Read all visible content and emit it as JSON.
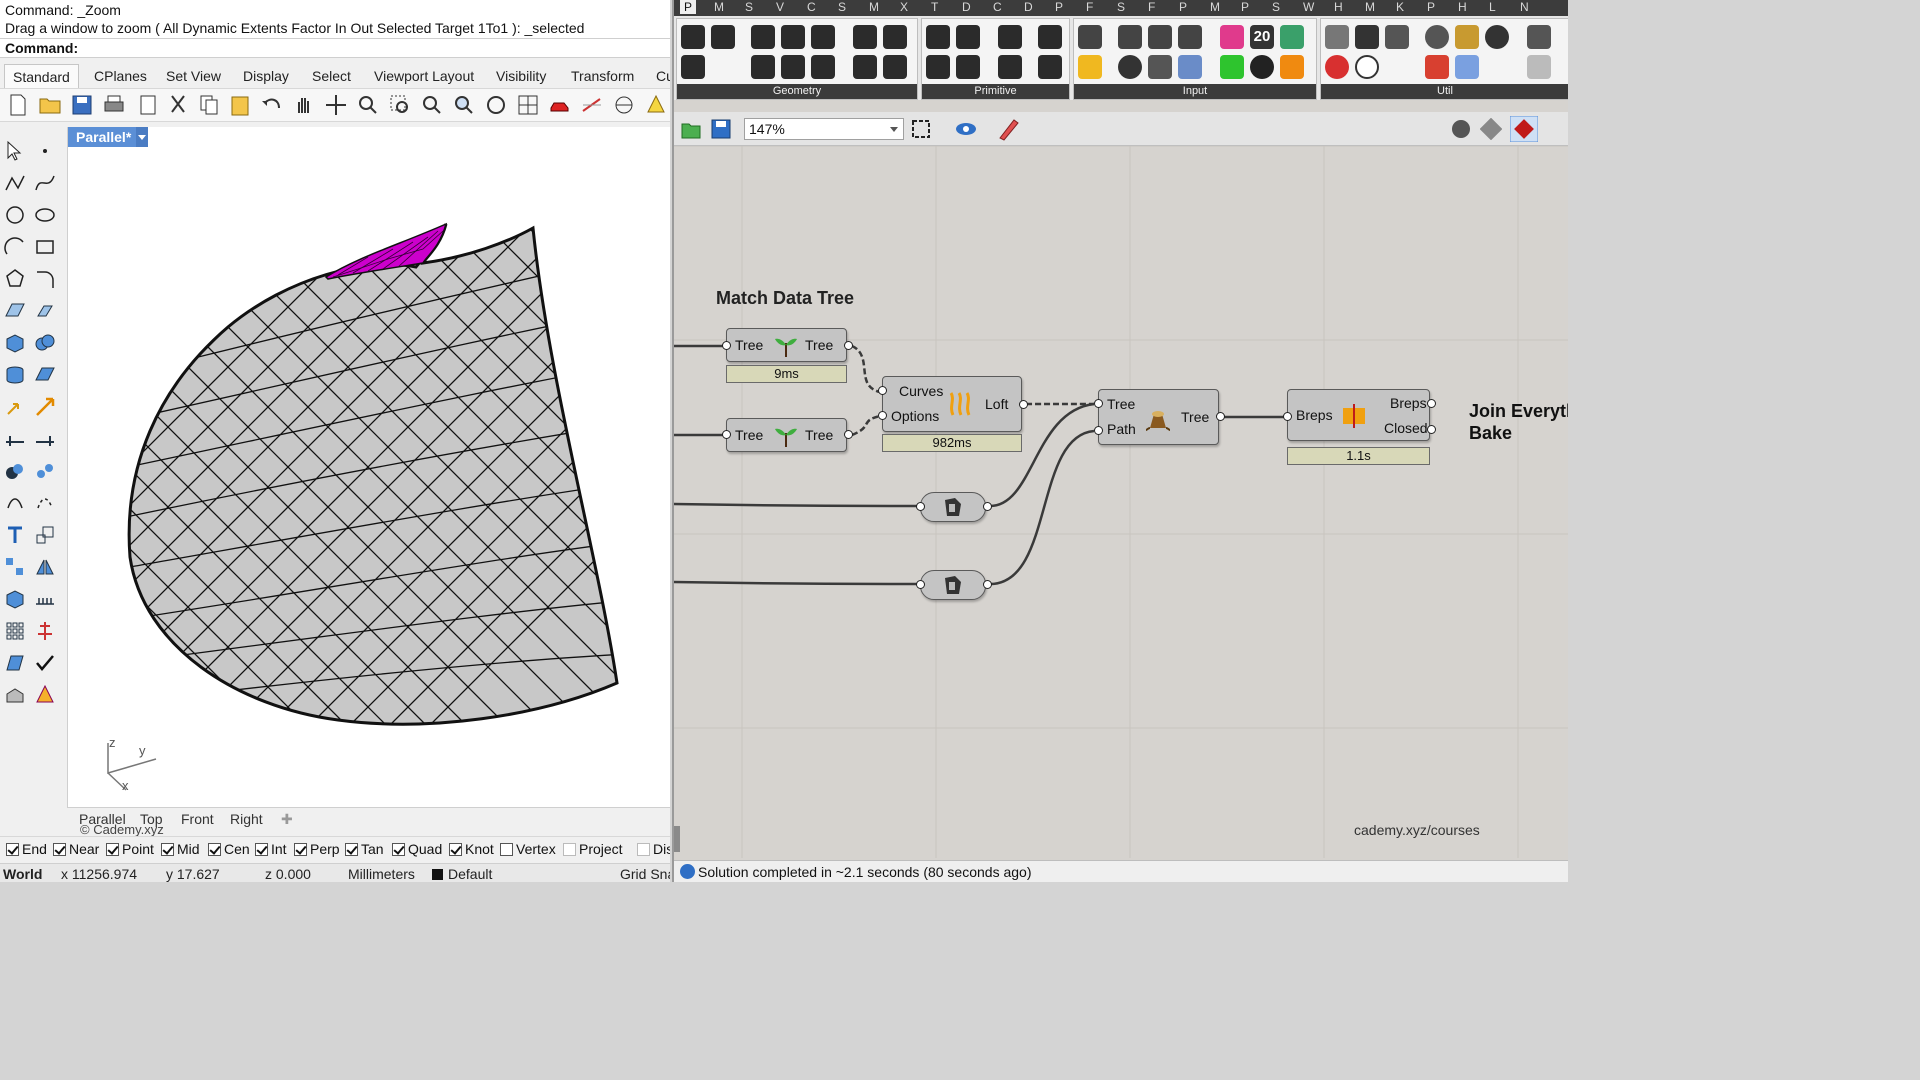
{
  "rhino": {
    "command_history": [
      "Command: _Zoom",
      "Drag a window to zoom ( All  Dynamic  Extents  Factor  In  Out  Selected  Target  1To1 ): _selected"
    ],
    "command_prompt": "Command:",
    "tabs": [
      "Standard",
      "CPlanes",
      "Set View",
      "Display",
      "Select",
      "Viewport Layout",
      "Visibility",
      "Transform",
      "Cu"
    ],
    "active_tab": "Standard",
    "viewport_label": "Parallel*",
    "axes": {
      "z": "z",
      "y": "y",
      "x": "x"
    },
    "viewport_tabs": [
      "Parallel",
      "Top",
      "Front",
      "Right"
    ],
    "watermark": "© Cademy.xyz",
    "osnaps": [
      {
        "label": "End",
        "checked": true
      },
      {
        "label": "Near",
        "checked": true
      },
      {
        "label": "Point",
        "checked": true
      },
      {
        "label": "Mid",
        "checked": true
      },
      {
        "label": "Cen",
        "checked": true
      },
      {
        "label": "Int",
        "checked": true
      },
      {
        "label": "Perp",
        "checked": true
      },
      {
        "label": "Tan",
        "checked": true
      },
      {
        "label": "Quad",
        "checked": true
      },
      {
        "label": "Knot",
        "checked": true
      },
      {
        "label": "Vertex",
        "checked": false
      },
      {
        "label": "Project",
        "checked": false
      },
      {
        "label": "Dis",
        "checked": false
      }
    ],
    "status": {
      "cplane": "World",
      "x": "x 11256.974",
      "y": "y 17.627",
      "z": "z 0.000",
      "units": "Millimeters",
      "layer": "Default",
      "grid_snap": "Grid Sna"
    },
    "colors": {
      "selection": "#cc00cc",
      "surface": "#c8c8c8"
    }
  },
  "grasshopper": {
    "categories": [
      "P",
      "M",
      "S",
      "V",
      "C",
      "S",
      "M",
      "X",
      "T",
      "D",
      "C",
      "D",
      "P",
      "F",
      "S",
      "F",
      "P",
      "M",
      "P",
      "S",
      "W",
      "H",
      "M",
      "K",
      "P",
      "H",
      "L",
      "N"
    ],
    "ribbon_groups": [
      "Geometry",
      "Primitive",
      "Input",
      "Util"
    ],
    "zoom": "147%",
    "group_title": "Match Data Tree",
    "nodes": {
      "tree1": {
        "in": "Tree",
        "out": "Tree",
        "time": "9ms"
      },
      "tree2": {
        "in": "Tree",
        "out": "Tree"
      },
      "loft": {
        "in1": "Curves",
        "in2": "Options",
        "out": "Loft",
        "time": "982ms"
      },
      "pathmapper": {
        "in1": "Tree",
        "in2": "Path",
        "out": "Tree"
      },
      "join": {
        "in": "Breps",
        "out1": "Breps",
        "out2": "Closed",
        "time": "1.1s"
      }
    },
    "note_line1": "Join Everyth",
    "note_line2": "Bake",
    "watermark": "cademy.xyz/courses",
    "status": "Solution completed in ~2.1 seconds (80 seconds ago)"
  }
}
